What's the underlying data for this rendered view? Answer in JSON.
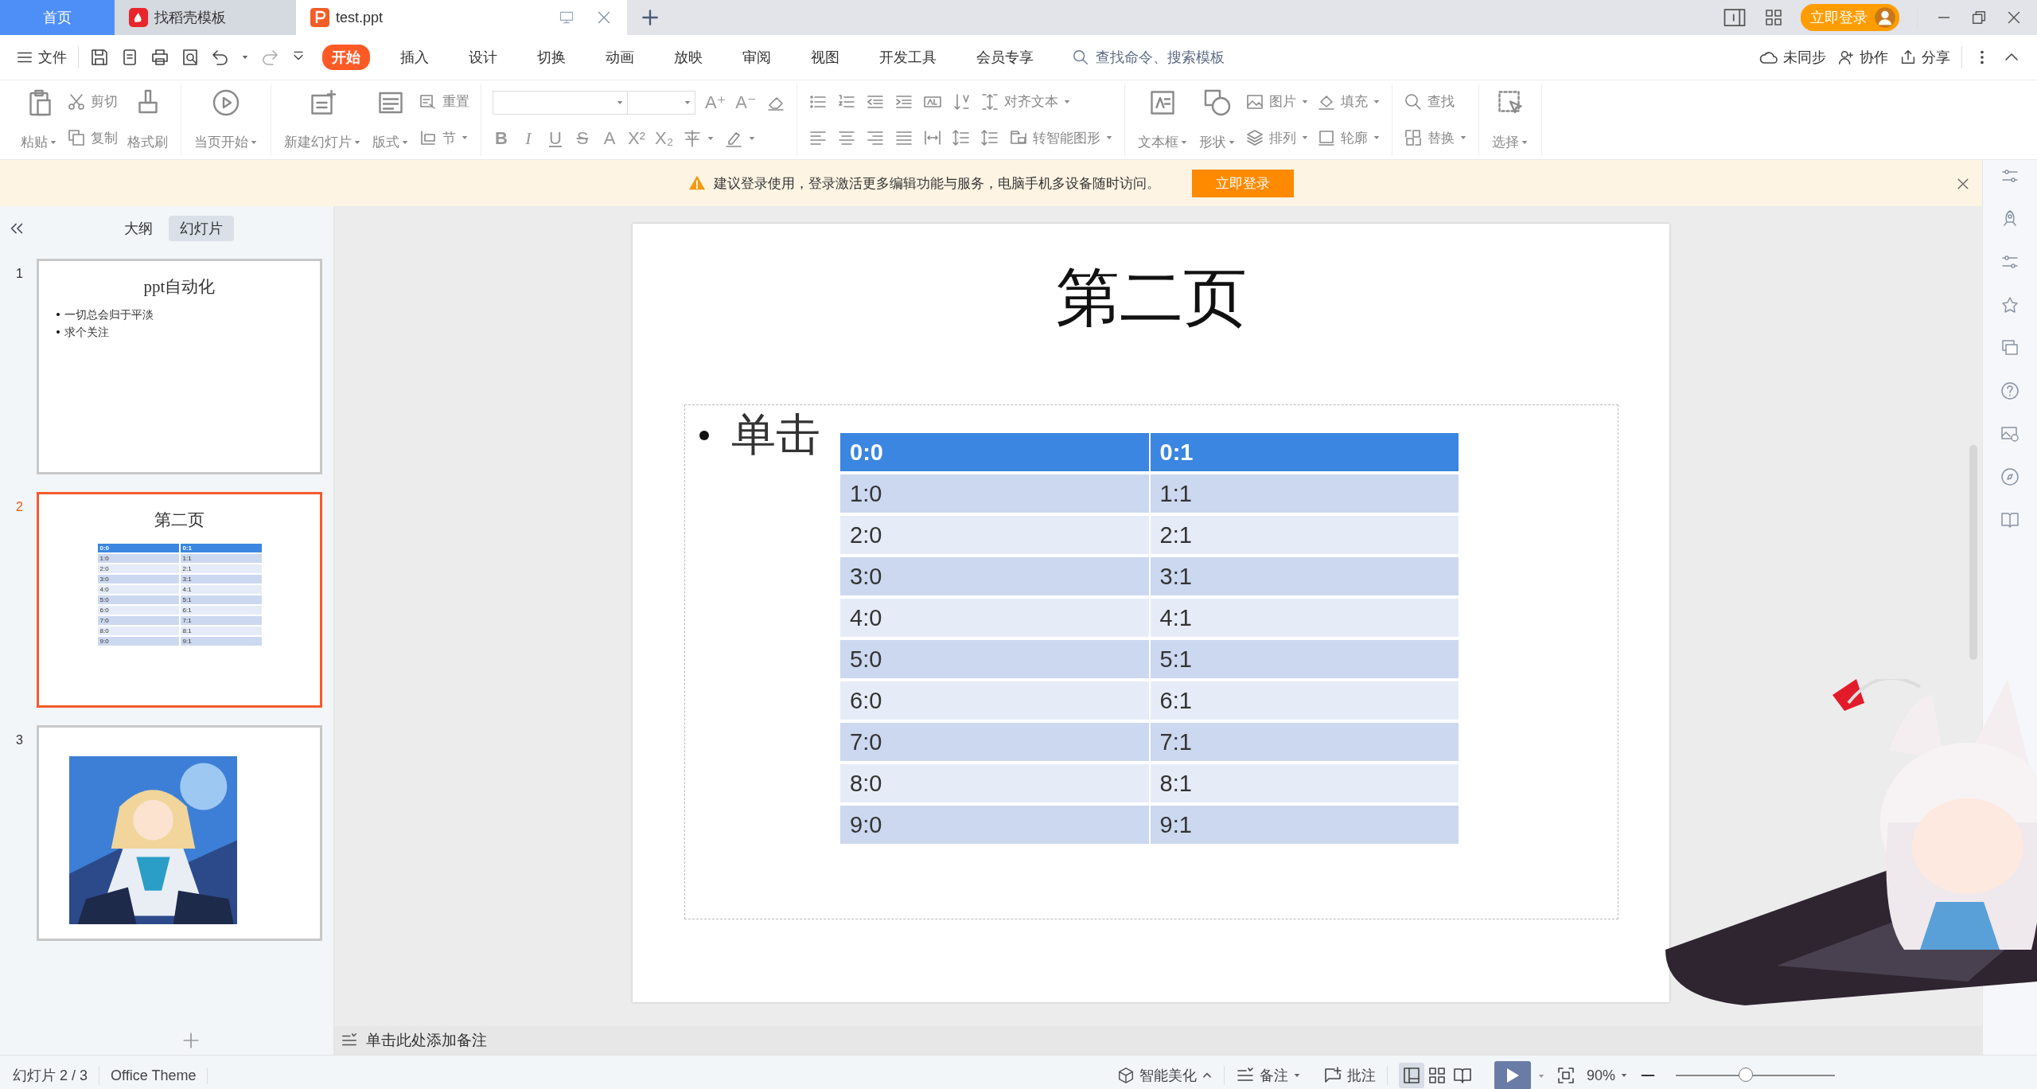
{
  "tabs": [
    {
      "label": "首页",
      "kind": "home",
      "selected": false
    },
    {
      "label": "找稻壳模板",
      "kind": "docer",
      "selected": false
    },
    {
      "label": "test.ppt",
      "kind": "doc",
      "selected": true
    }
  ],
  "login_button": "立即登录",
  "menu": {
    "file": "文件",
    "tabs": [
      {
        "label": "开始",
        "selected": true
      },
      {
        "label": "插入",
        "selected": false
      },
      {
        "label": "设计",
        "selected": false
      },
      {
        "label": "切换",
        "selected": false
      },
      {
        "label": "动画",
        "selected": false
      },
      {
        "label": "放映",
        "selected": false
      },
      {
        "label": "审阅",
        "selected": false
      },
      {
        "label": "视图",
        "selected": false
      },
      {
        "label": "开发工具",
        "selected": false
      },
      {
        "label": "会员专享",
        "selected": false
      }
    ],
    "search_placeholder": "查找命令、搜索模板",
    "sync": "未同步",
    "collab": "协作",
    "share": "分享"
  },
  "ribbon": {
    "groups": [
      {
        "kind": "buttons",
        "items": [
          {
            "label": "粘贴",
            "kind": "large",
            "caret": true
          },
          {
            "label": "剪切",
            "kind": "small",
            "caret": false
          },
          {
            "label": "复制",
            "kind": "small",
            "caret": false
          },
          {
            "label": "格式刷",
            "kind": "large",
            "caret": false
          }
        ]
      },
      {
        "kind": "buttons",
        "items": [
          {
            "label": "当页开始",
            "kind": "large",
            "caret": true
          }
        ]
      },
      {
        "kind": "buttons",
        "items": [
          {
            "label": "新建幻灯片",
            "kind": "large",
            "caret": true
          },
          {
            "label": "版式",
            "kind": "large",
            "caret": true
          },
          {
            "label": "重置",
            "kind": "small",
            "caret": false
          },
          {
            "label": "节",
            "kind": "small",
            "caret": true
          }
        ]
      },
      {
        "kind": "font",
        "size_buttons": [
          "A⁺",
          "A⁻"
        ],
        "format_buttons": [
          "B",
          "I",
          "U",
          "S",
          "A",
          "X²",
          "X₂"
        ]
      },
      {
        "kind": "paragraph",
        "items": [
          {
            "label": "对齐文本",
            "caret": true
          },
          {
            "label": "转智能图形",
            "caret": true
          }
        ]
      },
      {
        "kind": "buttons",
        "items": [
          {
            "label": "文本框",
            "kind": "large",
            "caret": true
          },
          {
            "label": "形状",
            "kind": "large",
            "caret": true
          },
          {
            "label": "图片",
            "kind": "small",
            "caret": true
          },
          {
            "label": "排列",
            "kind": "small",
            "caret": true
          },
          {
            "label": "填充",
            "kind": "small",
            "caret": true
          },
          {
            "label": "轮廓",
            "kind": "small",
            "caret": true
          }
        ]
      },
      {
        "kind": "buttons",
        "items": [
          {
            "label": "查找",
            "kind": "small",
            "caret": false
          },
          {
            "label": "替换",
            "kind": "small",
            "caret": true
          }
        ]
      },
      {
        "kind": "buttons",
        "items": [
          {
            "label": "选择",
            "kind": "large",
            "caret": true
          }
        ]
      }
    ]
  },
  "notice": {
    "text": "建议登录使用，登录激活更多编辑功能与服务，电脑手机多设备随时访问。",
    "button": "立即登录"
  },
  "panel": {
    "tabs": [
      {
        "label": "大纲",
        "selected": false
      },
      {
        "label": "幻灯片",
        "selected": true
      }
    ],
    "slides": [
      {
        "number": "1",
        "selected": false,
        "kind": "text",
        "title": "ppt自动化",
        "bullets": [
          "一切总会归于平淡",
          "求个关注"
        ]
      },
      {
        "number": "2",
        "selected": true,
        "kind": "table",
        "title": "第二页",
        "table": {
          "columns": [
            "0:0",
            "0:1"
          ],
          "rows": [
            [
              "1:0",
              "1:1"
            ],
            [
              "2:0",
              "2:1"
            ],
            [
              "3:0",
              "3:1"
            ],
            [
              "4:0",
              "4:1"
            ],
            [
              "5:0",
              "5:1"
            ],
            [
              "6:0",
              "6:1"
            ],
            [
              "7:0",
              "7:1"
            ],
            [
              "8:0",
              "8:1"
            ],
            [
              "9:0",
              "9:1"
            ]
          ]
        }
      },
      {
        "number": "3",
        "selected": false,
        "kind": "picture"
      }
    ]
  },
  "slide": {
    "title": "第二页",
    "bullet": "单击",
    "table": {
      "columns": [
        "0:0",
        "0:1"
      ],
      "rows": [
        [
          "1:0",
          "1:1"
        ],
        [
          "2:0",
          "2:1"
        ],
        [
          "3:0",
          "3:1"
        ],
        [
          "4:0",
          "4:1"
        ],
        [
          "5:0",
          "5:1"
        ],
        [
          "6:0",
          "6:1"
        ],
        [
          "7:0",
          "7:1"
        ],
        [
          "8:0",
          "8:1"
        ],
        [
          "9:0",
          "9:1"
        ]
      ]
    }
  },
  "notes_placeholder": "单击此处添加备注",
  "status_bar": {
    "slide_count": "幻灯片 2 / 3",
    "theme": "Office Theme",
    "beautify": "智能美化",
    "notes": "备注",
    "comments": "批注",
    "views": [
      {
        "selected": true
      },
      {
        "selected": false
      },
      {
        "selected": false
      }
    ],
    "zoom": "90%",
    "zoom_slider": {
      "level": 0.44
    }
  }
}
